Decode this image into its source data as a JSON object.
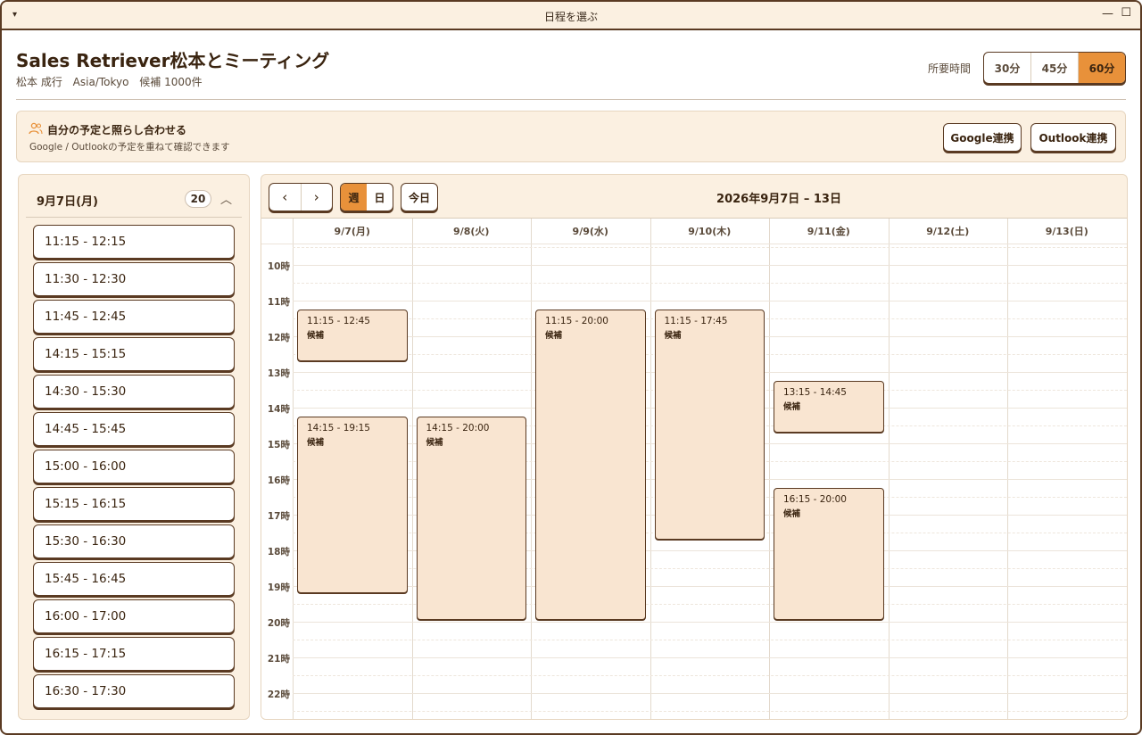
{
  "window": {
    "title": "日程を選ぶ",
    "menu_icon": "caret-down-icon",
    "min_icon": "minimize-icon",
    "max_icon": "maximize-icon"
  },
  "header": {
    "title": "Sales Retriever松本とミーティング",
    "host": "松本 成行",
    "timezone": "Asia/Tokyo",
    "candidates": "候補 1000件",
    "duration_label": "所要時間",
    "durations": [
      "30分",
      "45分",
      "60分"
    ],
    "active_duration": "60分"
  },
  "sync": {
    "icon": "users-icon",
    "title": "自分の予定と照らし合わせる",
    "description": "Google / Outlookの予定を重ねて確認できます",
    "google_button": "Google連携",
    "outlook_button": "Outlook連携"
  },
  "day_list": {
    "date": "9月7日(月)",
    "count": "20",
    "slots": [
      "11:15 - 12:15",
      "11:30 - 12:30",
      "11:45 - 12:45",
      "14:15 - 15:15",
      "14:30 - 15:30",
      "14:45 - 15:45",
      "15:00 - 16:00",
      "15:15 - 16:15",
      "15:30 - 16:30",
      "15:45 - 16:45",
      "16:00 - 17:00",
      "16:15 - 17:15",
      "16:30 - 17:30"
    ]
  },
  "calendar": {
    "prev": "‹",
    "next": "›",
    "views": [
      "週",
      "日"
    ],
    "active_view": "週",
    "today": "今日",
    "range": "2026年9月7日 – 13日",
    "days": [
      "9/7(月)",
      "9/8(火)",
      "9/9(水)",
      "9/10(木)",
      "9/11(金)",
      "9/12(土)",
      "9/13(日)"
    ],
    "hours": [
      "10時",
      "11時",
      "12時",
      "13時",
      "14時",
      "15時",
      "16時",
      "17時",
      "18時",
      "19時",
      "20時",
      "21時",
      "22時"
    ],
    "first_hour": 10,
    "events": [
      {
        "day": 0,
        "start": 11.25,
        "end": 12.75,
        "time": "11:15 - 12:45",
        "label": "候補"
      },
      {
        "day": 0,
        "start": 14.25,
        "end": 19.25,
        "time": "14:15 - 19:15",
        "label": "候補"
      },
      {
        "day": 1,
        "start": 14.25,
        "end": 20.0,
        "time": "14:15 - 20:00",
        "label": "候補"
      },
      {
        "day": 2,
        "start": 11.25,
        "end": 20.0,
        "time": "11:15 - 20:00",
        "label": "候補"
      },
      {
        "day": 3,
        "start": 11.25,
        "end": 17.75,
        "time": "11:15 - 17:45",
        "label": "候補"
      },
      {
        "day": 4,
        "start": 13.25,
        "end": 14.75,
        "time": "13:15 - 14:45",
        "label": "候補"
      },
      {
        "day": 4,
        "start": 16.25,
        "end": 20.0,
        "time": "16:15 - 20:00",
        "label": "候補"
      }
    ]
  }
}
